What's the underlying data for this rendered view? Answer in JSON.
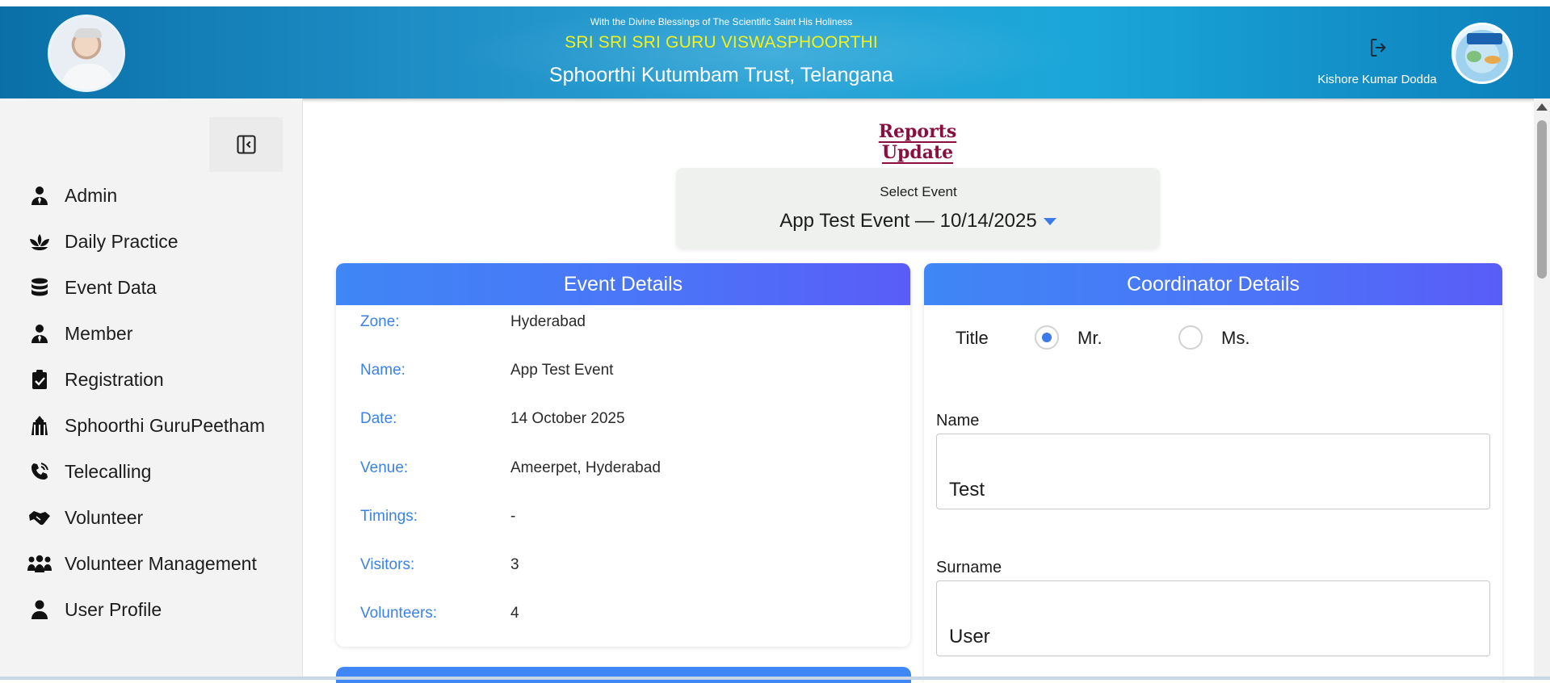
{
  "header": {
    "blessing": "With the Divine Blessings of The Scientific Saint His Holiness",
    "guru_name": "SRI SRI SRI GURU VISWASPHOORTHI",
    "trust_name": "Sphoorthi Kutumbam Trust, Telangana",
    "user_name": "Kishore Kumar Dodda"
  },
  "sidebar": {
    "items": [
      {
        "label": "Admin",
        "icon": "user-tie-icon"
      },
      {
        "label": "Daily Practice",
        "icon": "lotus-icon"
      },
      {
        "label": "Event Data",
        "icon": "database-icon"
      },
      {
        "label": "Member",
        "icon": "user-tie-icon"
      },
      {
        "label": "Registration",
        "icon": "clipboard-check-icon"
      },
      {
        "label": "Sphoorthi GuruPeetham",
        "icon": "temple-icon"
      },
      {
        "label": "Telecalling",
        "icon": "phone-icon"
      },
      {
        "label": "Volunteer",
        "icon": "handshake-icon"
      },
      {
        "label": "Volunteer Management",
        "icon": "people-group-icon"
      },
      {
        "label": "User Profile",
        "icon": "user-icon"
      }
    ]
  },
  "main": {
    "page_title": "Reports Update",
    "select_event": {
      "caption": "Select Event",
      "value": "App Test Event — 10/14/2025"
    },
    "event_details": {
      "title": "Event Details",
      "rows": [
        {
          "key": "Zone:",
          "value": "Hyderabad"
        },
        {
          "key": "Name:",
          "value": "App Test Event"
        },
        {
          "key": "Date:",
          "value": "14 October 2025"
        },
        {
          "key": "Venue:",
          "value": "Ameerpet, Hyderabad"
        },
        {
          "key": "Timings:",
          "value": "-"
        },
        {
          "key": "Visitors:",
          "value": "3"
        },
        {
          "key": "Volunteers:",
          "value": "4"
        }
      ]
    },
    "coordinator_details": {
      "title": "Coordinator Details",
      "title_label": "Title",
      "options": [
        "Mr.",
        "Ms."
      ],
      "selected": "Mr.",
      "name_label": "Name",
      "name_value": "Test",
      "surname_label": "Surname",
      "surname_value": "User"
    }
  },
  "colors": {
    "header_blue": "#1d8cc4",
    "panel_header": "#4c73f8",
    "key_text": "#3a82e8",
    "title_maroon": "#8a0f3f",
    "guru_name_yellow": "#f3f11c"
  }
}
